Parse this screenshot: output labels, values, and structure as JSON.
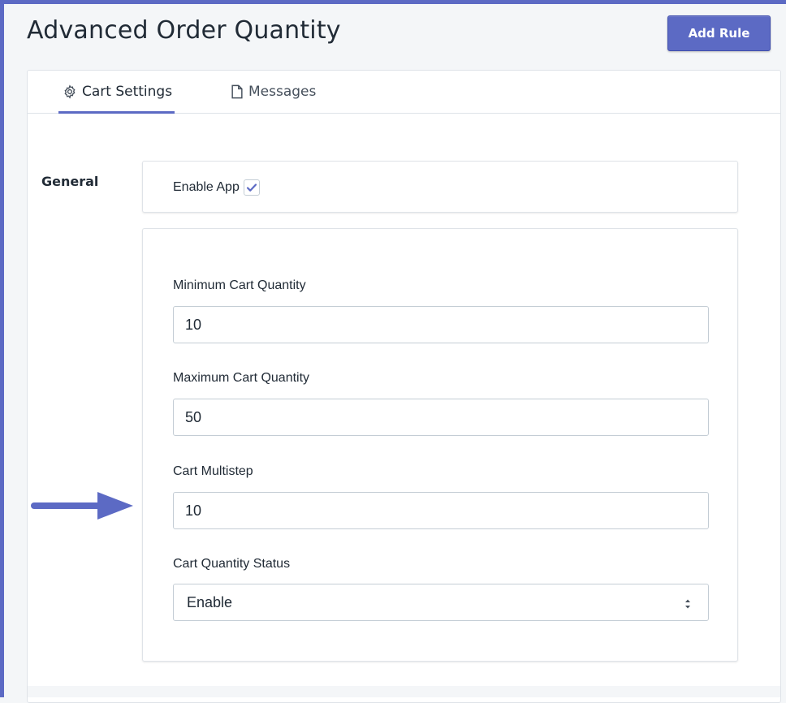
{
  "page": {
    "title": "Advanced Order Quantity",
    "add_rule_label": "Add Rule"
  },
  "tabs": [
    {
      "label": "Cart Settings",
      "icon": "gear-icon",
      "active": true
    },
    {
      "label": "Messages",
      "icon": "document-icon",
      "active": false
    }
  ],
  "general": {
    "section_label": "General",
    "enable_app_label": "Enable App",
    "enable_app_checked": true
  },
  "fields": {
    "min_cart_quantity": {
      "label": "Minimum Cart Quantity",
      "value": "10"
    },
    "max_cart_quantity": {
      "label": "Maximum Cart Quantity",
      "value": "50"
    },
    "cart_multistep": {
      "label": "Cart Multistep",
      "value": "10"
    },
    "cart_quantity_status": {
      "label": "Cart Quantity Status",
      "selected": "Enable"
    }
  },
  "colors": {
    "accent": "#5c6ac4",
    "border": "#dfe3e8",
    "text": "#212b36"
  }
}
